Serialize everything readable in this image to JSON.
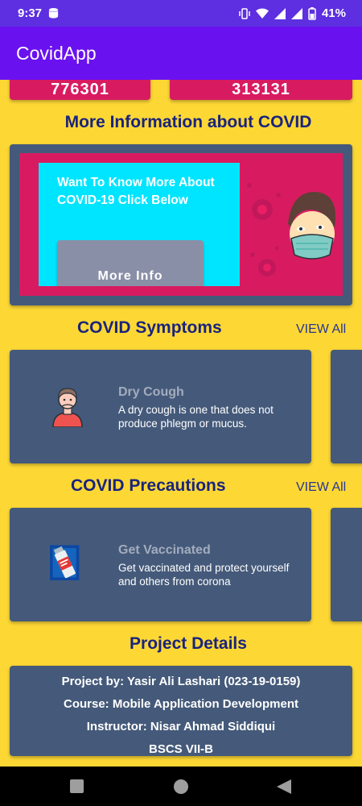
{
  "status_bar": {
    "time": "9:37",
    "battery": "41%"
  },
  "app_bar": {
    "title": "CovidApp"
  },
  "stats": {
    "left_value": "776301",
    "right_value": "313131"
  },
  "more_info": {
    "title": "More Information about COVID",
    "banner_text": "Want To Know More About COVID-19 Click Below",
    "button_label": "More Info"
  },
  "symptoms": {
    "title": "COVID Symptoms",
    "view_all": "VIEW All",
    "items": [
      {
        "title": "Dry Cough",
        "desc": "A dry cough is one that does not produce phlegm or mucus.",
        "icon": "coughing-person-icon"
      }
    ]
  },
  "precautions": {
    "title": "COVID Precautions",
    "view_all": "VIEW All",
    "items": [
      {
        "title": "Get Vaccinated",
        "desc": "Get vaccinated and protect yourself and others from corona",
        "icon": "vaccine-vial-icon"
      }
    ]
  },
  "project": {
    "title": "Project Details",
    "lines": [
      "Project by: Yasir Ali Lashari (023-19-0159)",
      "Course: Mobile Application Development",
      "Instructor: Nisar Ahmad Siddiqui",
      "BSCS VII-B"
    ]
  },
  "colors": {
    "status_bar": "#5d2fe0",
    "app_bar": "#6a11f0",
    "background": "#fdd835",
    "card": "#455a7a",
    "pink": "#d81b60",
    "cyan": "#00e5ff",
    "title": "#1a237e"
  }
}
